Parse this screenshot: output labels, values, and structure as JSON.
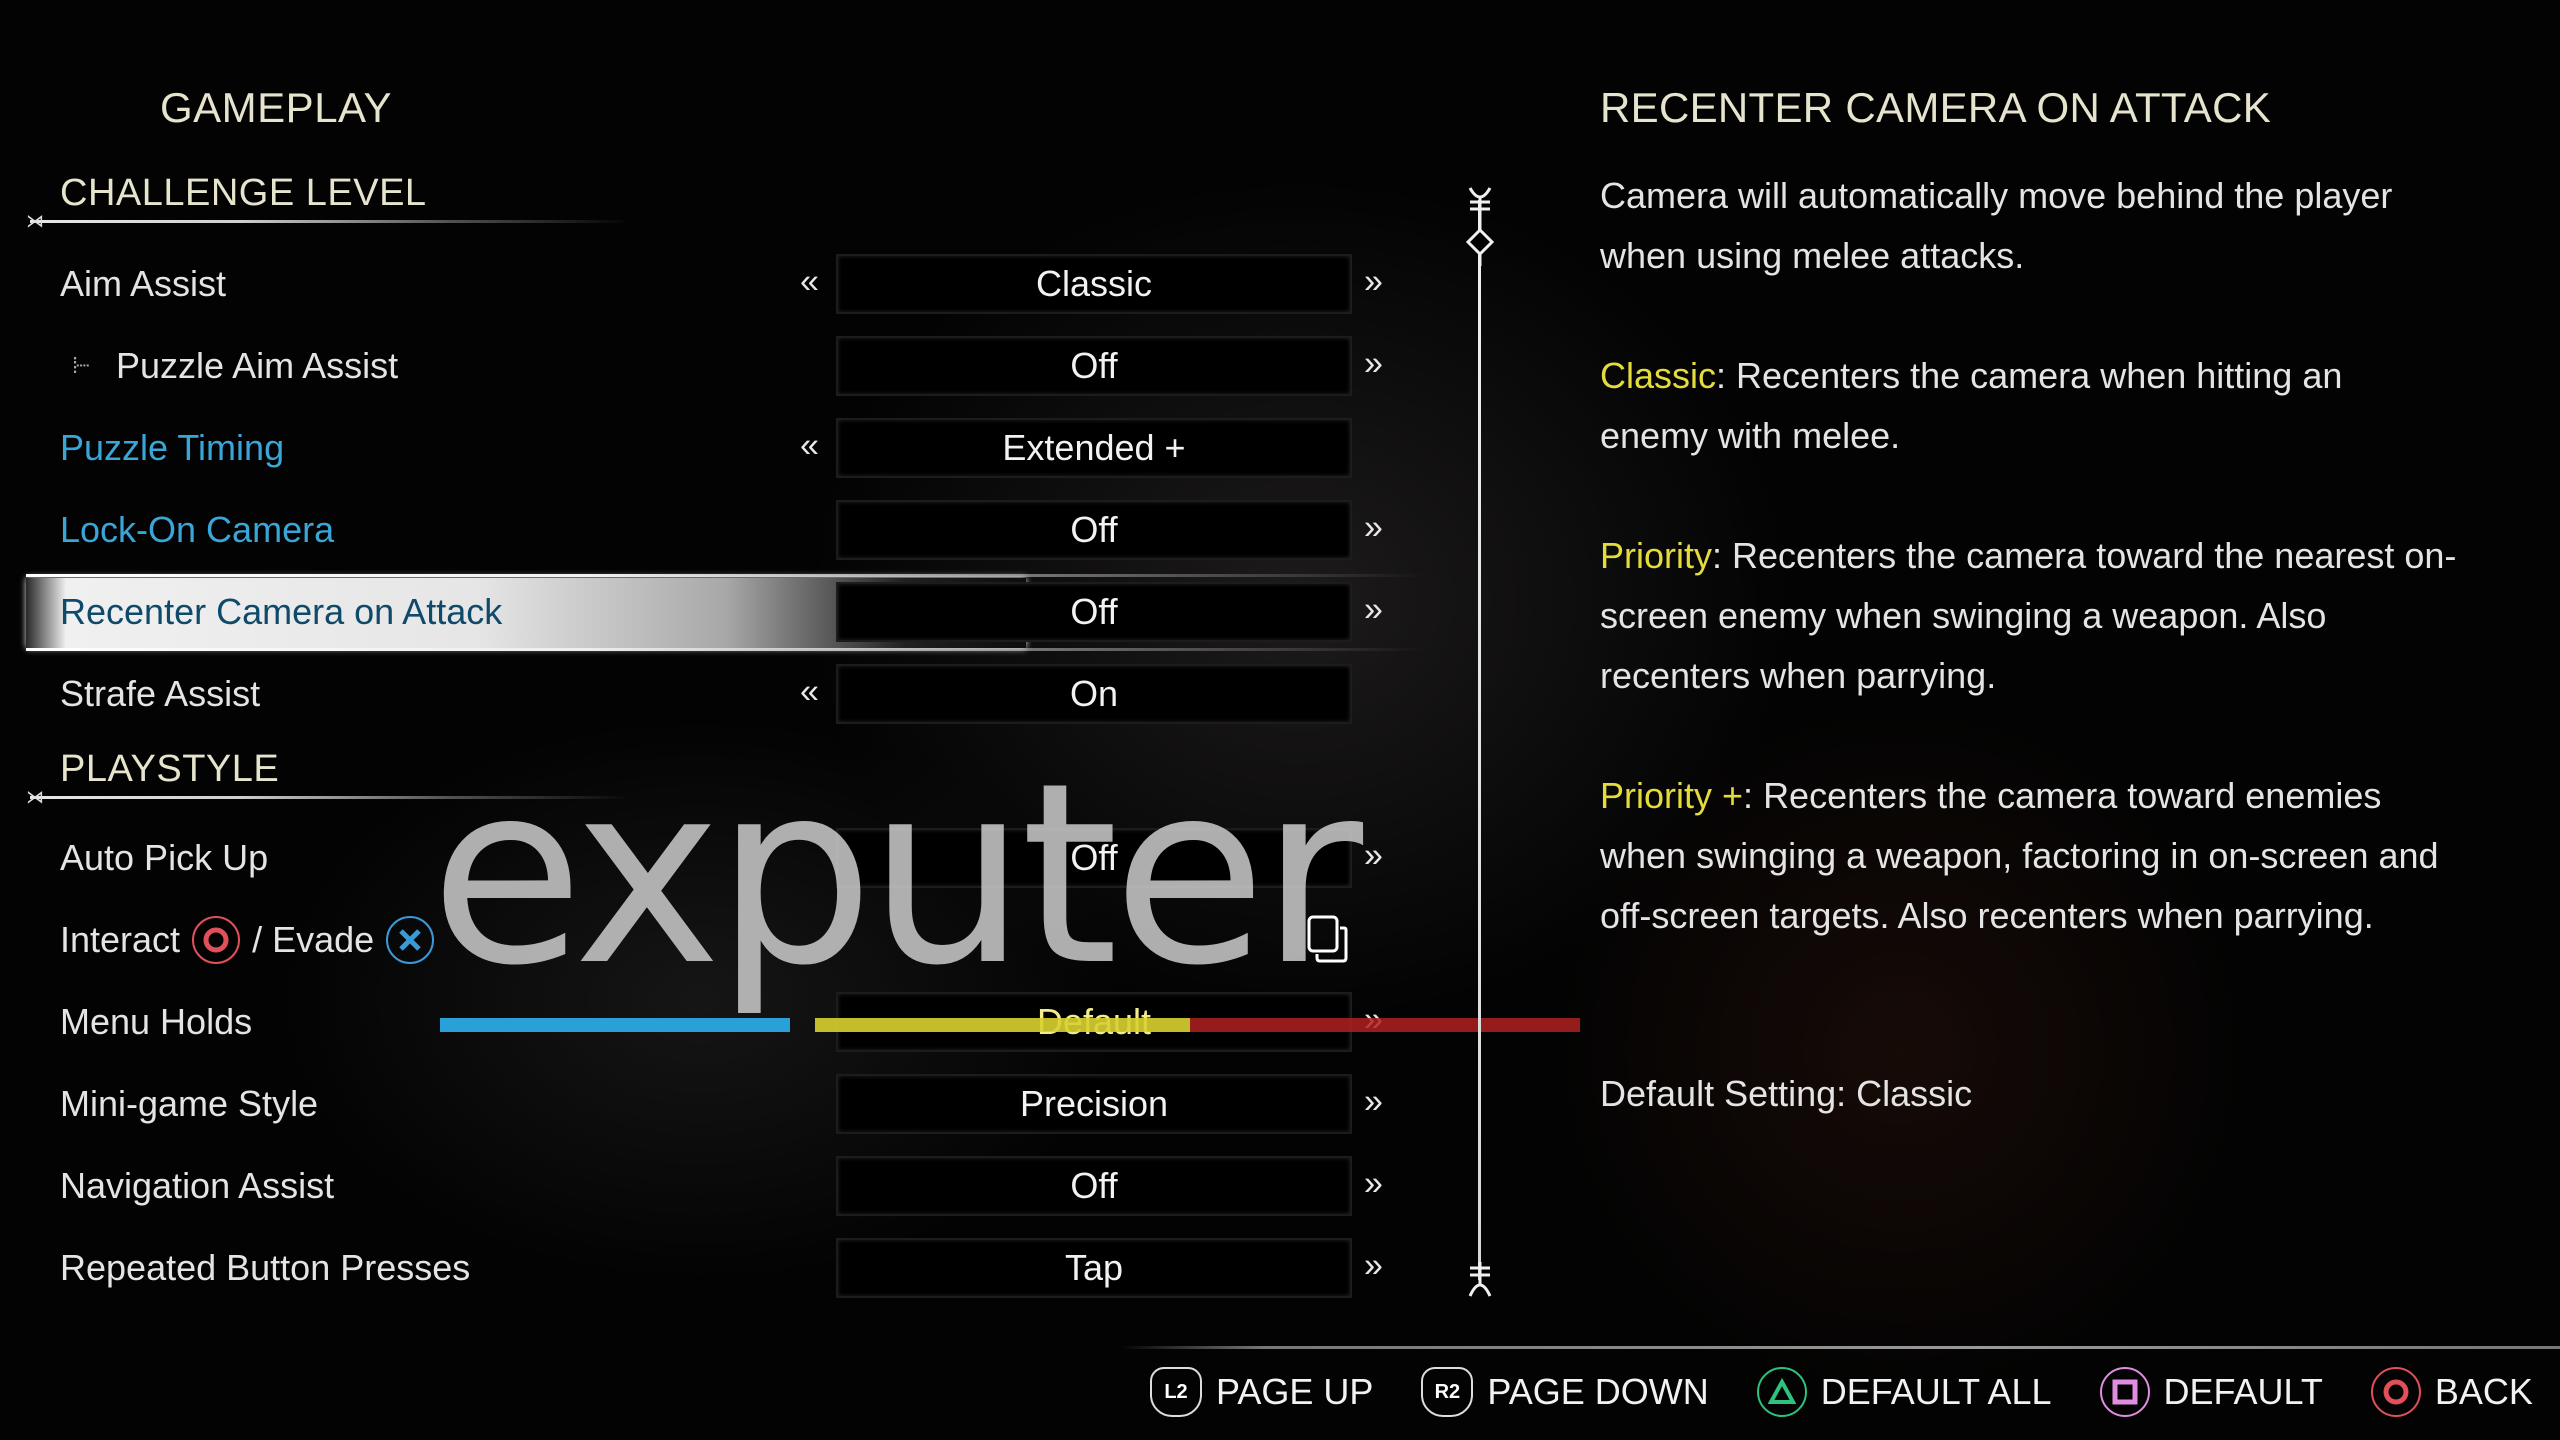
{
  "page": {
    "title": "GAMEPLAY"
  },
  "sections": [
    {
      "title": "CHALLENGE LEVEL",
      "rows": [
        {
          "label": "Aim Assist",
          "value": "Classic",
          "left_arrow": true,
          "right_arrow": true,
          "style": "normal"
        },
        {
          "label": "Puzzle Aim Assist",
          "value": "Off",
          "left_arrow": false,
          "right_arrow": true,
          "style": "sub"
        },
        {
          "label": "Puzzle Timing",
          "value": "Extended +",
          "left_arrow": true,
          "right_arrow": false,
          "style": "blue"
        },
        {
          "label": "Lock-On Camera",
          "value": "Off",
          "left_arrow": false,
          "right_arrow": true,
          "style": "blue"
        },
        {
          "label": "Recenter Camera on Attack",
          "value": "Off",
          "left_arrow": false,
          "right_arrow": true,
          "style": "selected"
        },
        {
          "label": "Strafe Assist",
          "value": "On",
          "left_arrow": true,
          "right_arrow": false,
          "style": "normal"
        }
      ]
    },
    {
      "title": "PLAYSTYLE",
      "rows": [
        {
          "label": "Auto Pick Up",
          "value": "Off",
          "left_arrow": false,
          "right_arrow": true,
          "style": "normal"
        },
        {
          "label_parts": [
            "Interact",
            "/ Evade"
          ],
          "glyphs": [
            "circle",
            "cross"
          ],
          "value": "",
          "icon": "remap-icon",
          "style": "normal"
        },
        {
          "label": "Menu Holds",
          "value": "Default",
          "left_arrow": false,
          "right_arrow": true,
          "style": "normal"
        },
        {
          "label": "Mini-game Style",
          "value": "Precision",
          "left_arrow": false,
          "right_arrow": true,
          "style": "normal"
        },
        {
          "label": "Navigation Assist",
          "value": "Off",
          "left_arrow": false,
          "right_arrow": true,
          "style": "normal"
        },
        {
          "label": "Repeated Button Presses",
          "value": "Tap",
          "left_arrow": false,
          "right_arrow": true,
          "style": "normal"
        }
      ]
    }
  ],
  "arrows": {
    "left": "«",
    "right": "»"
  },
  "info": {
    "title": "RECENTER CAMERA ON ATTACK",
    "description": "Camera will automatically move behind the player when using melee attacks.",
    "options": [
      {
        "name": "Classic",
        "text": "Recenters the camera when hitting an enemy with melee."
      },
      {
        "name": "Priority",
        "text": "Recenters the camera toward the nearest on-screen enemy when swinging a weapon. Also recenters when parrying."
      },
      {
        "name": "Priority +",
        "text": "Recenters the camera toward enemies when swinging a weapon, factoring in on-screen and off-screen targets. Also recenters when parrying."
      }
    ],
    "default_setting": "Default Setting: Classic"
  },
  "footer": {
    "items": [
      {
        "button": "L2",
        "label": "PAGE UP",
        "icon": "l2-trigger-icon"
      },
      {
        "button": "R2",
        "label": "PAGE DOWN",
        "icon": "r2-trigger-icon"
      },
      {
        "button": "triangle",
        "label": "DEFAULT ALL",
        "icon": "triangle-button-icon"
      },
      {
        "button": "square",
        "label": "DEFAULT",
        "icon": "square-button-icon"
      },
      {
        "button": "circle",
        "label": "BACK",
        "icon": "circle-button-icon"
      }
    ]
  },
  "watermark": {
    "text": "exputer"
  },
  "colors": {
    "header": "#e6e4cc",
    "blue_label": "#3aa6d8",
    "selected_label": "#0f4a6a",
    "keyword": "#e4dc3c",
    "triangle": "#2ec27e",
    "square": "#e08ce0",
    "circle": "#e0505a",
    "cross": "#3a9ad8",
    "wm_blue": "#2aa0d8",
    "wm_yellow": "#d8d030",
    "wm_red": "#b02020"
  }
}
